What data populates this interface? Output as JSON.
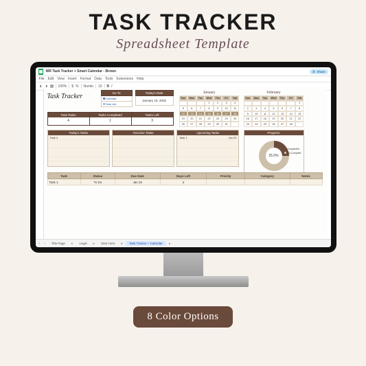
{
  "hero": {
    "title": "TASK TRACKER",
    "subtitle": "Spreadsheet Template"
  },
  "badge": "8 Color Options",
  "doc": {
    "title": "WR Task Tracker + Smart Calendar - Brown",
    "share": "Share"
  },
  "menus": [
    "File",
    "Edit",
    "View",
    "Insert",
    "Format",
    "Data",
    "Tools",
    "Extensions",
    "Help"
  ],
  "toolbar": {
    "zoom": "100%",
    "font": "Nunito",
    "size": "10"
  },
  "sheet": {
    "title": "Task Tracker",
    "goto": {
      "head": "Go To",
      "calendar": "Calendar",
      "tasklist": "Task List"
    },
    "today": {
      "head": "Today's Date",
      "value": "January 18, 2025"
    },
    "calendars": [
      {
        "name": "January",
        "dows": [
          "Sun",
          "Mon",
          "Tue",
          "Wed",
          "Thu",
          "Fri",
          "Sat"
        ],
        "rows": [
          [
            "",
            "",
            "",
            "1",
            "2",
            "3",
            "4"
          ],
          [
            "5",
            "6",
            "7",
            "8",
            "9",
            "10",
            "11"
          ],
          [
            "12",
            "13",
            "14",
            "15",
            "16",
            "17",
            "18"
          ],
          [
            "19",
            "20",
            "21",
            "22",
            "23",
            "24",
            "25"
          ],
          [
            "26",
            "27",
            "28",
            "29",
            "30",
            "31",
            ""
          ]
        ],
        "highlight": [
          2
        ]
      },
      {
        "name": "February",
        "dows": [
          "Sun",
          "Mon",
          "Tue",
          "Wed",
          "Thu",
          "Fri",
          "Sat"
        ],
        "rows": [
          [
            "",
            "",
            "",
            "",
            "",
            "",
            "1"
          ],
          [
            "2",
            "3",
            "4",
            "5",
            "6",
            "7",
            "8"
          ],
          [
            "9",
            "10",
            "11",
            "12",
            "13",
            "14",
            "15"
          ],
          [
            "16",
            "17",
            "18",
            "19",
            "20",
            "21",
            "22"
          ],
          [
            "23",
            "24",
            "25",
            "26",
            "27",
            "28",
            ""
          ]
        ],
        "highlight": []
      }
    ],
    "stats": [
      {
        "h": "Total Tasks",
        "v": "4"
      },
      {
        "h": "Tasks Completed",
        "v": "1"
      },
      {
        "h": "Tasks Left",
        "v": "3"
      }
    ],
    "lists": [
      {
        "h": "Today's Tasks",
        "rows": [
          {
            "a": "Task 4",
            "b": ""
          }
        ]
      },
      {
        "h": "Overdue Tasks",
        "rows": []
      },
      {
        "h": "Upcoming Tasks",
        "rows": [
          {
            "a": "Task 1",
            "b": "Jan 20"
          }
        ]
      }
    ],
    "progress": {
      "h": "Progress",
      "center": "25.0%",
      "legend": [
        "Completed",
        "To Complete"
      ]
    },
    "table": {
      "headers": [
        "Task",
        "Status",
        "Due Date",
        "Days Left",
        "Priority",
        "Category",
        "Notes"
      ],
      "rows": [
        [
          "Task 1",
          "To Do",
          "Jan 20",
          "2",
          "",
          "",
          ""
        ]
      ]
    }
  },
  "tabs": {
    "items": [
      "Title Page",
      "Legal",
      "Start Here",
      "Task Tracker + Calendar"
    ],
    "active": 3
  },
  "chart_data": {
    "type": "pie",
    "title": "Progress",
    "series": [
      {
        "name": "Completed",
        "value": 25.0
      },
      {
        "name": "To Complete",
        "value": 75.0
      }
    ],
    "center_label": "25.0%"
  }
}
